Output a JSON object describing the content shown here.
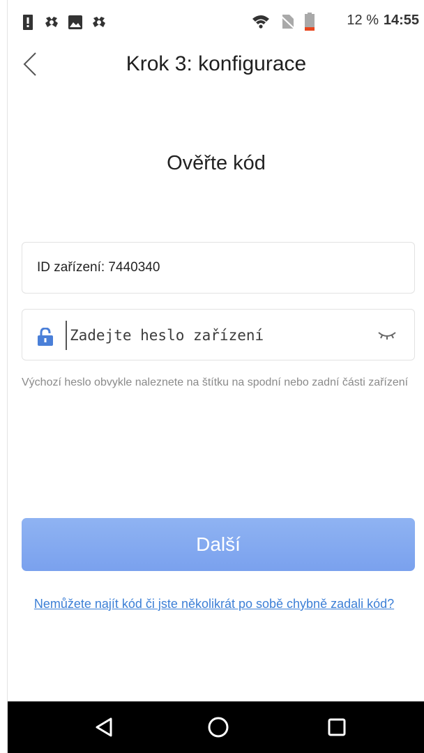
{
  "status_bar": {
    "left_icons": [
      "alert-icon",
      "bug-icon",
      "image-icon",
      "bug-icon"
    ],
    "right_icons": [
      "wifi-icon",
      "no-sim-icon",
      "battery-low-icon"
    ],
    "battery_percent": "12 %",
    "time": "14:55"
  },
  "header": {
    "title": "Krok 3: konfigurace",
    "back_icon": "chevron-left-icon"
  },
  "main": {
    "heading": "Ověřte kód",
    "device_id_label": "ID zařízení: 7440340",
    "password": {
      "placeholder": "Zadejte heslo zařízení",
      "value": "",
      "lock_icon": "lock-icon",
      "toggle_icon": "eye-closed-icon"
    },
    "hint": "Výchozí heslo obvykle naleznete na štítku na spodní nebo zadní části zařízení",
    "next_button_label": "Další",
    "help_link": "Nemůžete najít kód či jste několikrát po sobě chybně zadali kód?"
  },
  "nav_bar": {
    "icons": [
      "back-triangle-icon",
      "home-circle-icon",
      "recents-square-icon"
    ]
  },
  "colors": {
    "accent_button": "#7aa1ee",
    "link": "#3c7fd6",
    "lock_icon": "#4a7fd8",
    "battery_low": "#e8461e"
  }
}
